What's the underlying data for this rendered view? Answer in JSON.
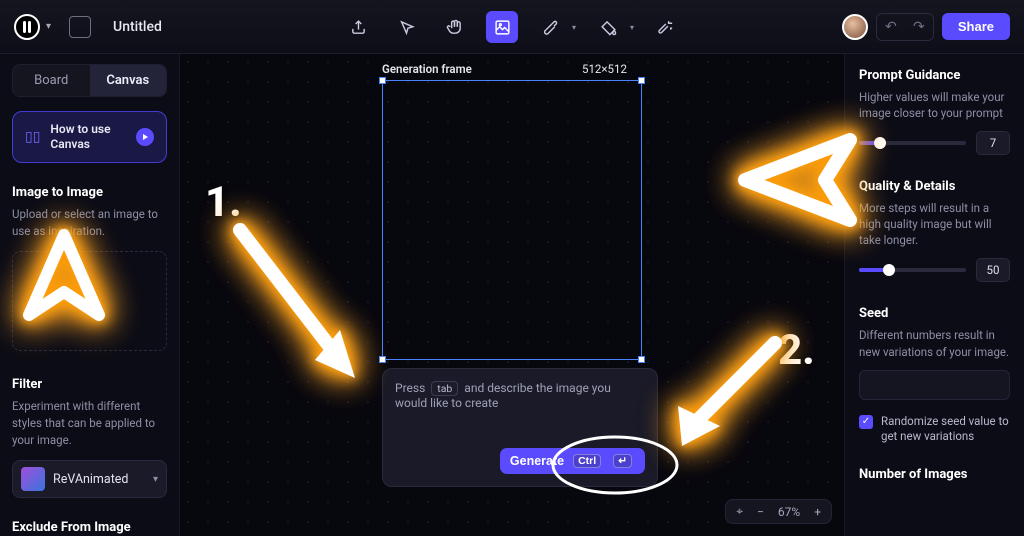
{
  "header": {
    "title": "Untitled",
    "share_label": "Share"
  },
  "tabs": {
    "board": "Board",
    "canvas": "Canvas"
  },
  "howto": {
    "label": "How to use Canvas"
  },
  "left": {
    "img2img": {
      "title": "Image to Image",
      "desc": "Upload or select an image to use as inspiration."
    },
    "filter": {
      "title": "Filter",
      "desc": "Experiment with different styles that can be applied to your image.",
      "selected": "ReVAnimated"
    },
    "exclude": {
      "title": "Exclude From Image"
    }
  },
  "canvas": {
    "frame_label": "Generation frame",
    "frame_dim": "512×512",
    "prompt_pre": "Press",
    "prompt_tab": "tab",
    "prompt_post": "and describe the image you would like to create",
    "generate": "Generate",
    "ctrl": "Ctrl",
    "zoom": "67%"
  },
  "right": {
    "guidance": {
      "title": "Prompt Guidance",
      "desc": "Higher values will make your image closer to your prompt",
      "value": "7"
    },
    "quality": {
      "title": "Quality & Details",
      "desc": "More steps will result in a high quality image but will take longer.",
      "value": "50"
    },
    "seed": {
      "title": "Seed",
      "desc": "Different numbers result in new variations of your image.",
      "checkbox": "Randomize seed value to get new variations"
    },
    "num": {
      "title": "Number of Images"
    }
  },
  "anno": {
    "one": "1.",
    "two": "2."
  }
}
